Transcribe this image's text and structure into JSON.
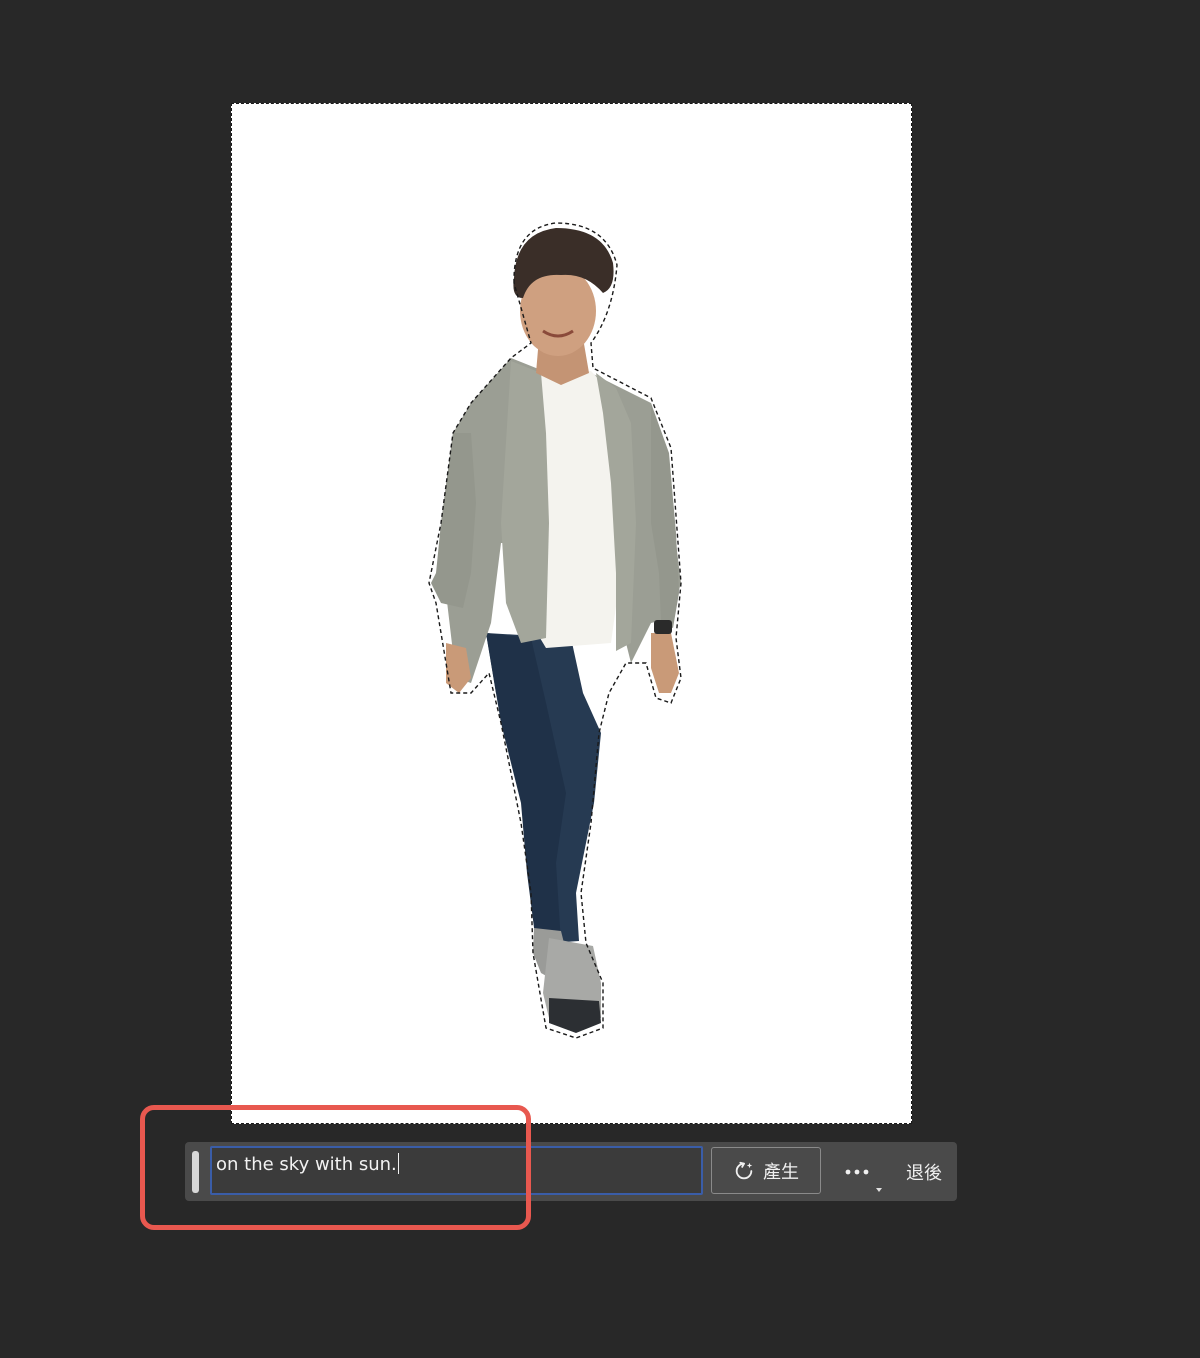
{
  "canvas": {
    "background_color": "#ffffff",
    "selection": "marching-ants"
  },
  "subject_image": {
    "icon": "person-cutout-photo"
  },
  "taskbar": {
    "prompt_value": "on the sky with sun.",
    "prompt_focus_color": "#3a5da8",
    "generate_label": "產生",
    "generate_icon": "generative-sparkle-icon",
    "more_icon": "more-options-icon",
    "back_label": "退後"
  },
  "annotation": {
    "color": "#e8584f"
  }
}
